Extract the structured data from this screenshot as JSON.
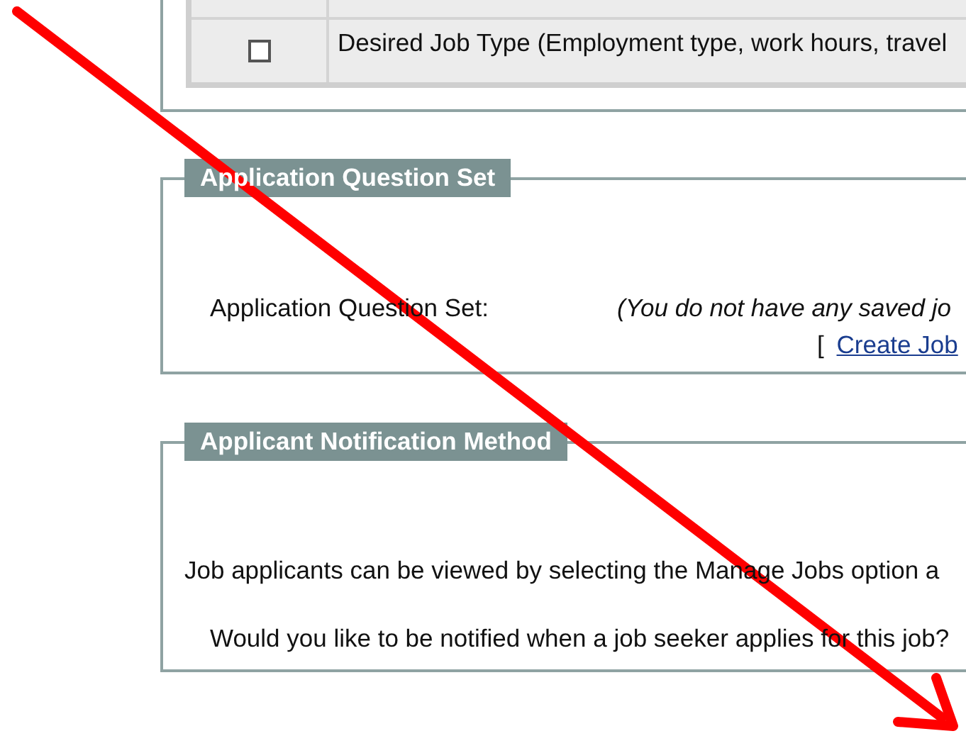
{
  "profile_table": {
    "rows": [
      {
        "checked": false,
        "label": "Desired Job Type (Employment type, work hours, travel"
      }
    ]
  },
  "question_set": {
    "legend": "Application Question Set",
    "label": "Application Question Set:",
    "value": "(You do not have any saved jo",
    "link_open": "[",
    "link": "Create Job"
  },
  "notification": {
    "legend": "Applicant Notification Method",
    "info": "Job applicants can be viewed by selecting the Manage Jobs option a",
    "question": "Would you like to be notified when a job seeker applies for this job?"
  }
}
